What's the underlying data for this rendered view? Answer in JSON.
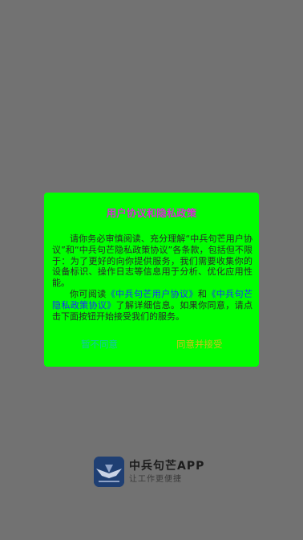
{
  "brand": {
    "title": "中兵句芒APP",
    "subtitle": "让工作更便捷",
    "logo_icon": "app-logo-icon"
  },
  "dialog": {
    "title": "用户协议和隐私政策",
    "para1": "请你务必审慎阅读、充分理解“中兵句芒用户协议”和“中兵句芒隐私政策协议”各条款，包括但不限于：为了更好的向你提供服务，我们需要收集你的设备标识、操作日志等信息用于分析、优化应用性能。",
    "para2_prefix": "你可阅读",
    "link_user_agreement": "《中兵句芒用户协议》",
    "para2_and": "和",
    "link_privacy_policy": "《中兵句芒隐私政策协议》",
    "para2_suffix": "了解详细信息。如果你同意，请点击下面按钮开始接受我们的服务。",
    "decline_label": "暂不同意",
    "accept_label": "同意并接受"
  },
  "colors": {
    "overlay_bg": "#727272",
    "dialog_bg": "#00ff00",
    "title": "#d62bd4",
    "link": "#1a2cff",
    "decline": "#13c6a8",
    "accept": "#d2bf1a"
  }
}
